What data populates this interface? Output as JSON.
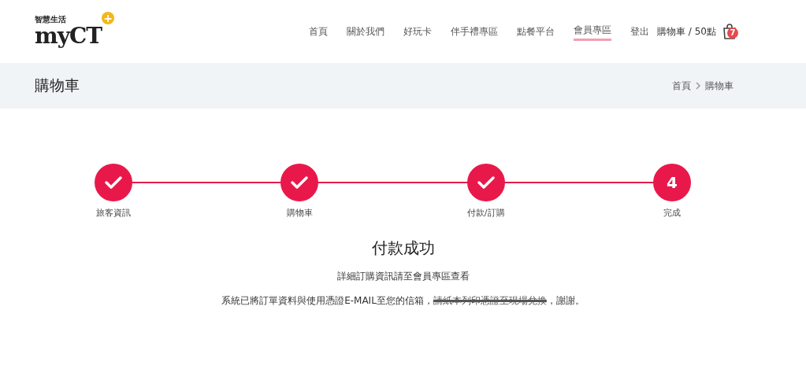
{
  "logo": {
    "tagline": "智慧生活",
    "name": "myCT",
    "badge": "+"
  },
  "nav": [
    {
      "label": "首頁",
      "selected": false
    },
    {
      "label": "關於我們",
      "selected": false
    },
    {
      "label": "好玩卡",
      "selected": false
    },
    {
      "label": "伴手禮專區",
      "selected": false
    },
    {
      "label": "點餐平台",
      "selected": false
    },
    {
      "label": "會員專區",
      "selected": true
    },
    {
      "label": "登出",
      "selected": false
    }
  ],
  "cart": {
    "label": "購物車 / 50點",
    "count": "7"
  },
  "page_title": "購物車",
  "breadcrumb": [
    "首頁",
    "購物車"
  ],
  "steps": [
    {
      "label": "旅客資訊",
      "done": true
    },
    {
      "label": "購物車",
      "done": true
    },
    {
      "label": "付款/訂購",
      "done": true
    },
    {
      "label": "完成",
      "done": false,
      "number": "4"
    }
  ],
  "result": {
    "title": "付款成功",
    "subtitle": "詳細訂購資訊請至會員專區查看",
    "message_before": "系統已將訂單資料與使用憑證E-MAIL至您的信箱，",
    "message_struck": "請紙本列印憑證至現場兌換",
    "message_after": "，謝謝。"
  }
}
